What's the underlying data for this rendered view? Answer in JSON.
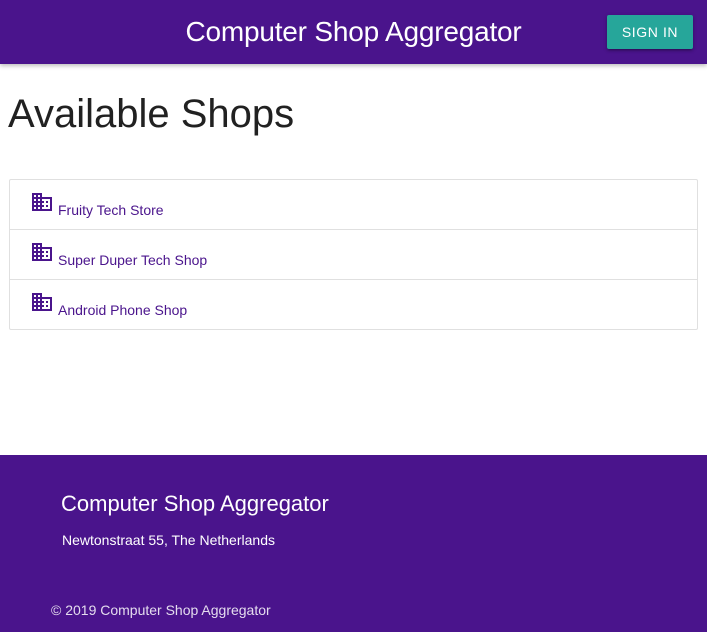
{
  "header": {
    "brand": "Computer Shop Aggregator",
    "signin_label": "SIGN IN"
  },
  "main": {
    "title": "Available Shops",
    "shops": [
      {
        "name": "Fruity Tech Store",
        "icon": "business-icon"
      },
      {
        "name": "Super Duper Tech Shop",
        "icon": "business-icon"
      },
      {
        "name": "Android Phone Shop",
        "icon": "business-icon"
      }
    ]
  },
  "footer": {
    "title": "Computer Shop Aggregator",
    "address": "Newtonstraat 55, The Netherlands",
    "copyright": "© 2019 Computer Shop Aggregator"
  },
  "colors": {
    "primary": "#4a148c",
    "accent": "#26a69a"
  }
}
